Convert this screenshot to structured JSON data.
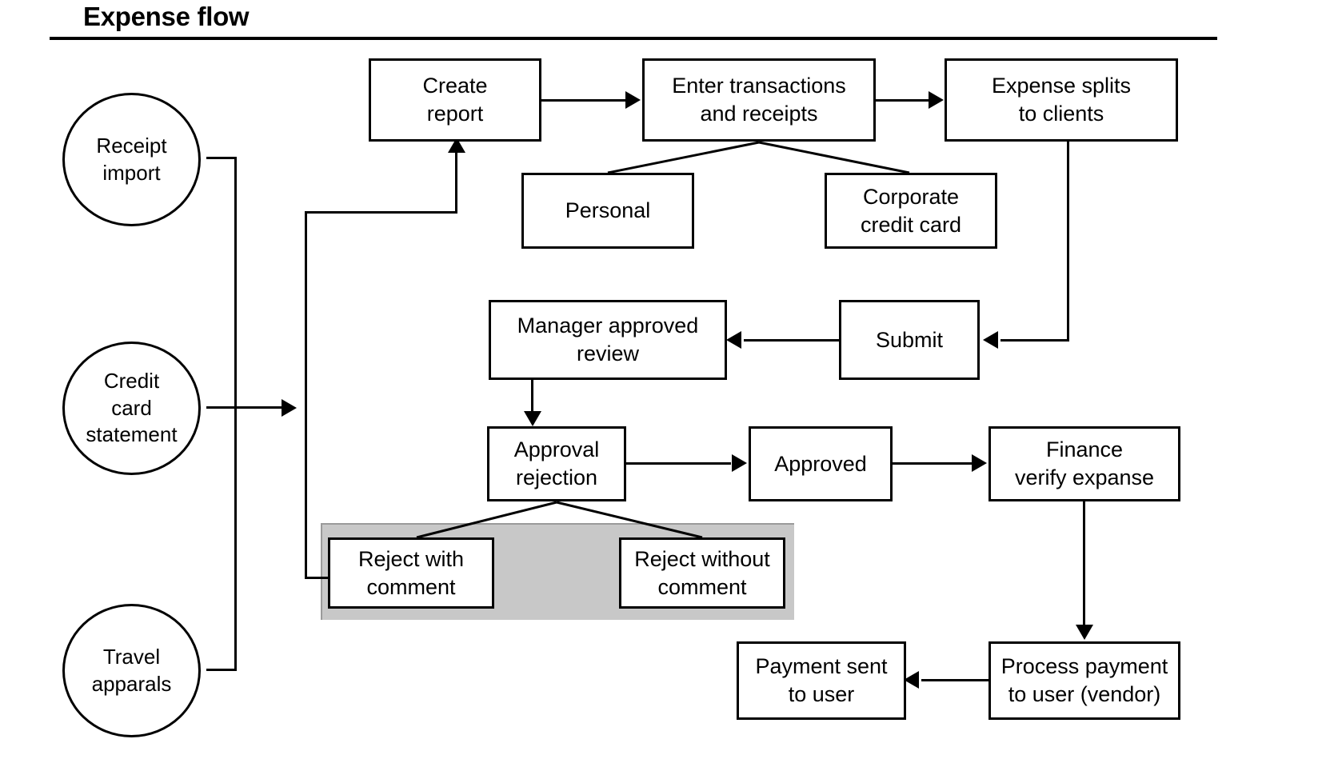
{
  "page": {
    "title": "Expense flow",
    "background": "#ffffff",
    "stroke_color": "#000000",
    "selection_color": "#c8c8c8"
  },
  "sources": [
    {
      "id": "receipt-import",
      "label": "Receipt\nimport"
    },
    {
      "id": "credit-card-statement",
      "label": "Credit\ncard\nstatement"
    },
    {
      "id": "travel-apparals",
      "label": "Travel\napparals"
    }
  ],
  "nodes": [
    {
      "id": "create-report",
      "label": "Create\nreport"
    },
    {
      "id": "enter-transactions",
      "label": "Enter transactions\nand receipts"
    },
    {
      "id": "expense-splits",
      "label": "Expense splits\nto clients"
    },
    {
      "id": "personal",
      "label": "Personal"
    },
    {
      "id": "corporate-credit-card",
      "label": "Corporate\ncredit card"
    },
    {
      "id": "manager-approved-review",
      "label": "Manager approved\nreview"
    },
    {
      "id": "submit",
      "label": "Submit"
    },
    {
      "id": "approval-rejection",
      "label": "Approval\nrejection"
    },
    {
      "id": "approved",
      "label": "Approved"
    },
    {
      "id": "finance-verify-expanse",
      "label": "Finance\nverify expanse"
    },
    {
      "id": "reject-with-comment",
      "label": "Reject with\ncomment"
    },
    {
      "id": "reject-without-comment",
      "label": "Reject without\ncomment"
    },
    {
      "id": "process-payment",
      "label": "Process payment\nto user (vendor)"
    },
    {
      "id": "payment-sent",
      "label": "Payment sent\nto user"
    }
  ]
}
